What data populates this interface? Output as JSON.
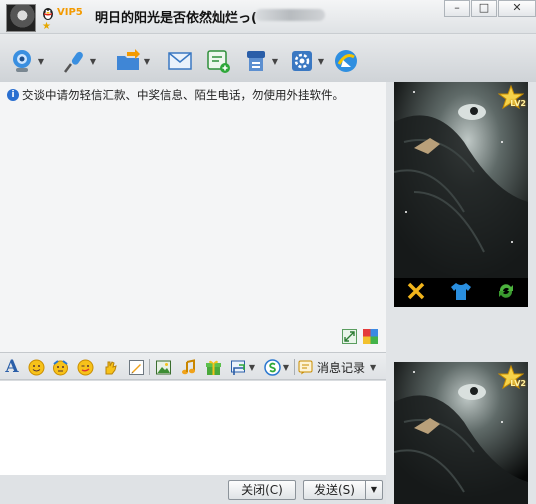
{
  "titlebar": {
    "vip_label": "VIP5",
    "nickname": "明日的阳光是否依然灿烂っ(",
    "minimize": "–",
    "maximize": "□",
    "close": "✕"
  },
  "toolbar": {
    "items": [
      {
        "icon": "video-call-icon",
        "dropdown": true
      },
      {
        "icon": "voice-call-icon",
        "dropdown": true
      },
      {
        "icon": "send-file-icon",
        "dropdown": true
      },
      {
        "icon": "email-icon",
        "dropdown": false
      },
      {
        "icon": "create-group-icon",
        "dropdown": false
      },
      {
        "icon": "app-manager-icon",
        "dropdown": true
      },
      {
        "icon": "settings-icon",
        "dropdown": true
      },
      {
        "icon": "qzone-icon",
        "dropdown": false
      }
    ]
  },
  "chat": {
    "notice": "交谈中请勿轻信汇款、中奖信息、陌生电话，勿使用外挂软件。"
  },
  "format_bar": {
    "font_label": "A",
    "history_label": "消息记录"
  },
  "bottom": {
    "close_label": "关闭(C)",
    "send_label": "发送(S)"
  },
  "show": {
    "level_label": "LV2"
  },
  "colors": {
    "accent_blue": "#2a5ea8",
    "vip_orange": "#f39a00",
    "chat_bg": "#f4f5f6"
  }
}
